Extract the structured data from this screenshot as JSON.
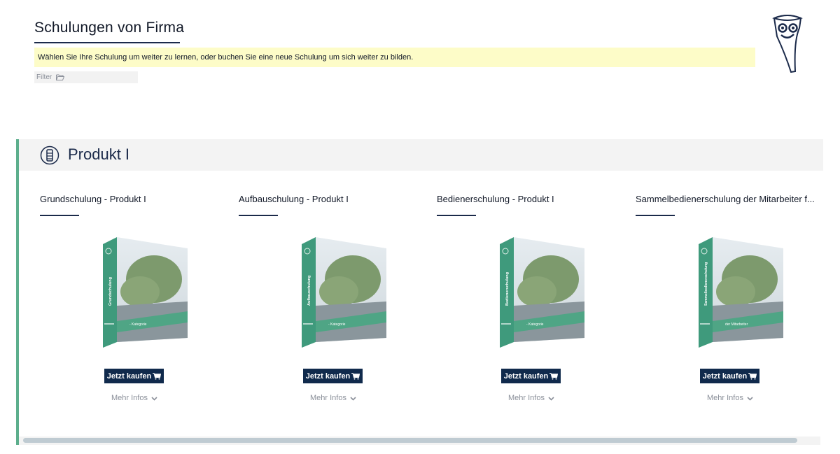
{
  "header": {
    "title": "Schulungen von Firma",
    "info": "Wählen Sie Ihre Schulung um weiter zu lernen, oder buchen Sie eine neue Schulung um sich weiter zu bilden.",
    "filter_label": "Filter"
  },
  "section": {
    "title": "Produkt I",
    "courses": [
      {
        "title": "Grundschulung - Produkt I",
        "box_label": "Grundschulung",
        "box_band": "- Kategorie"
      },
      {
        "title": "Aufbauschulung - Produkt I",
        "box_label": "Aufbauschulung",
        "box_band": "- Kategorie"
      },
      {
        "title": "Bedienerschulung - Produkt I",
        "box_label": "Bedienerschulung",
        "box_band": "- Kategorie"
      },
      {
        "title": "Sammelbedienerschulung der Mitarbeiter f...",
        "box_label": "Sammelbedienerschulung",
        "box_band": "der Mitarbeiter"
      }
    ]
  },
  "labels": {
    "buy": "Jetzt kaufen",
    "more": "Mehr Infos"
  },
  "colors": {
    "accent": "#5cae8c",
    "navy": "#102a4c",
    "info_bg": "#fdfcc8"
  },
  "icons": {
    "filter": "folder-open-icon",
    "cart": "shopping-cart-icon",
    "more": "chevron-down-icon",
    "section": "product-icon"
  }
}
